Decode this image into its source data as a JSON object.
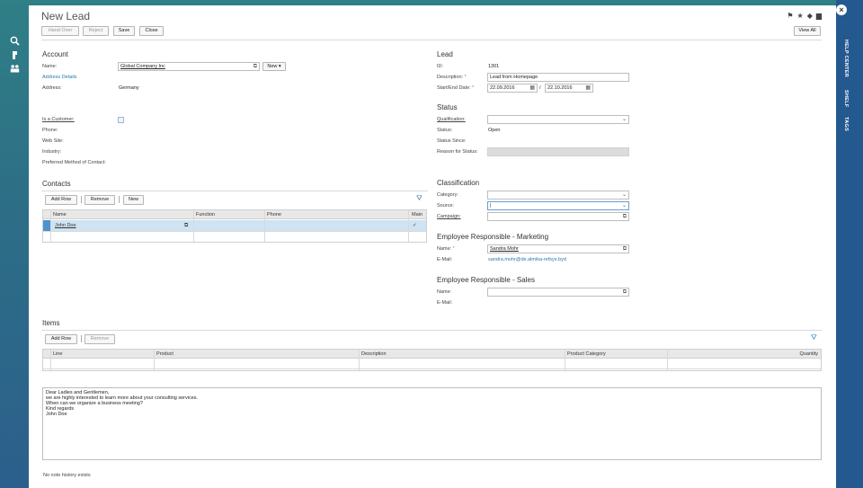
{
  "left_rail": {
    "icons": [
      "search-icon",
      "hand-icon",
      "people-icon"
    ]
  },
  "right_rail": {
    "tabs": [
      "HELP CENTER",
      "SHELF",
      "TAGS"
    ]
  },
  "window": {
    "title": "New Lead",
    "close_glyph": "×"
  },
  "toolbar": {
    "hand_over": "Hand Over",
    "reject": "Reject",
    "save": "Save",
    "close": "Close",
    "view_all": "View All"
  },
  "account": {
    "heading": "Account",
    "name_label": "Name:",
    "name_value": "Global Company Inc",
    "new_btn": "New",
    "address_details": "Address Details",
    "address_label": "Address:",
    "address_value": "Germany",
    "is_customer_label": "Is a Customer:",
    "phone_label": "Phone:",
    "website_label": "Web Site:",
    "industry_label": "Industry:",
    "contact_method_label": "Preferred Method of Contact:"
  },
  "lead": {
    "heading": "Lead",
    "id_label": "ID:",
    "id_value": "1301",
    "description_label": "Description:",
    "description_value": "Lead from Homepage",
    "dates_label": "Start/End Date:",
    "start_date": "22.09.2016",
    "date_sep": "/",
    "end_date": "22.10.2016"
  },
  "status": {
    "heading": "Status",
    "qualification_label": "Qualification:",
    "status_label": "Status:",
    "status_value": "Open",
    "since_label": "Status Since:",
    "reason_label": "Reason for Status:"
  },
  "contacts": {
    "heading": "Contacts",
    "add_row": "Add Row",
    "remove": "Remove",
    "new": "New",
    "columns": [
      "Name",
      "Function",
      "Phone",
      "Main"
    ],
    "rows": [
      {
        "name": "John Doe",
        "function": "",
        "phone": "",
        "main": "✓"
      }
    ]
  },
  "classification": {
    "heading": "Classification",
    "category_label": "Category:",
    "source_label": "Source:",
    "campaign_label": "Campaign:"
  },
  "marketing": {
    "heading": "Employee Responsible - Marketing",
    "name_label": "Name:",
    "name_value": "Sandra Mohr",
    "email_label": "E-Mail:",
    "email_value": "sandra.mohr@de.almika-refsys.byd"
  },
  "sales": {
    "heading": "Employee Responsible - Sales",
    "name_label": "Name:",
    "email_label": "E-Mail:"
  },
  "items": {
    "heading": "Items",
    "add_row": "Add Row",
    "remove": "Remove",
    "columns": [
      "Line",
      "Product",
      "Description",
      "Product Category",
      "Quantity"
    ]
  },
  "notes": {
    "lines": [
      "Dear Ladies and Gentlemen,",
      "we are highly interested to learn more about your consulting services.",
      "When can we organize a business meeting?",
      "Kind regards",
      "John Doe"
    ],
    "history": "No note history exists"
  }
}
